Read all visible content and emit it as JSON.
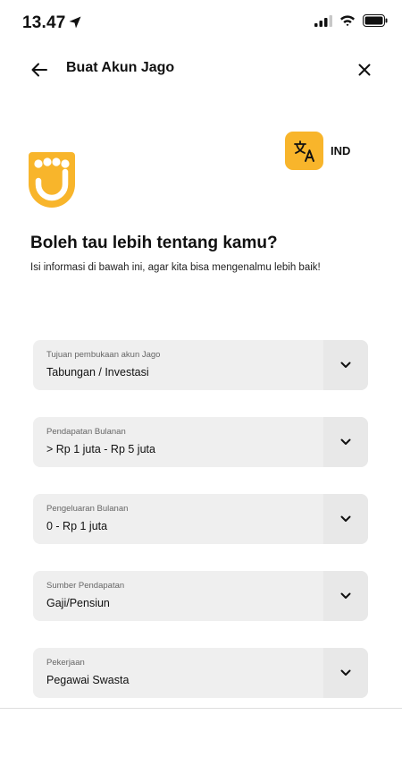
{
  "status_bar": {
    "time": "13.47"
  },
  "header": {
    "title": "Buat Akun Jago"
  },
  "language": {
    "label": "IND"
  },
  "intro": {
    "heading": "Boleh tau lebih tentang kamu?",
    "subheading": "Isi informasi di bawah ini, agar kita bisa mengenalmu lebih baik!"
  },
  "fields": [
    {
      "label": "Tujuan pembukaan akun Jago",
      "value": "Tabungan / Investasi"
    },
    {
      "label": "Pendapatan Bulanan",
      "value": "> Rp 1 juta - Rp 5 juta"
    },
    {
      "label": "Pengeluaran Bulanan",
      "value": "0 - Rp 1 juta"
    },
    {
      "label": "Sumber Pendapatan",
      "value": "Gaji/Pensiun"
    },
    {
      "label": "Pekerjaan",
      "value": "Pegawai Swasta"
    }
  ],
  "colors": {
    "brand": "#F8B52B",
    "field_bg": "#efefef"
  },
  "icons": [
    "location-arrow-icon",
    "signal-icon",
    "wifi-icon",
    "battery-icon",
    "back-arrow-icon",
    "close-icon",
    "translate-icon",
    "chevron-down-icon"
  ]
}
